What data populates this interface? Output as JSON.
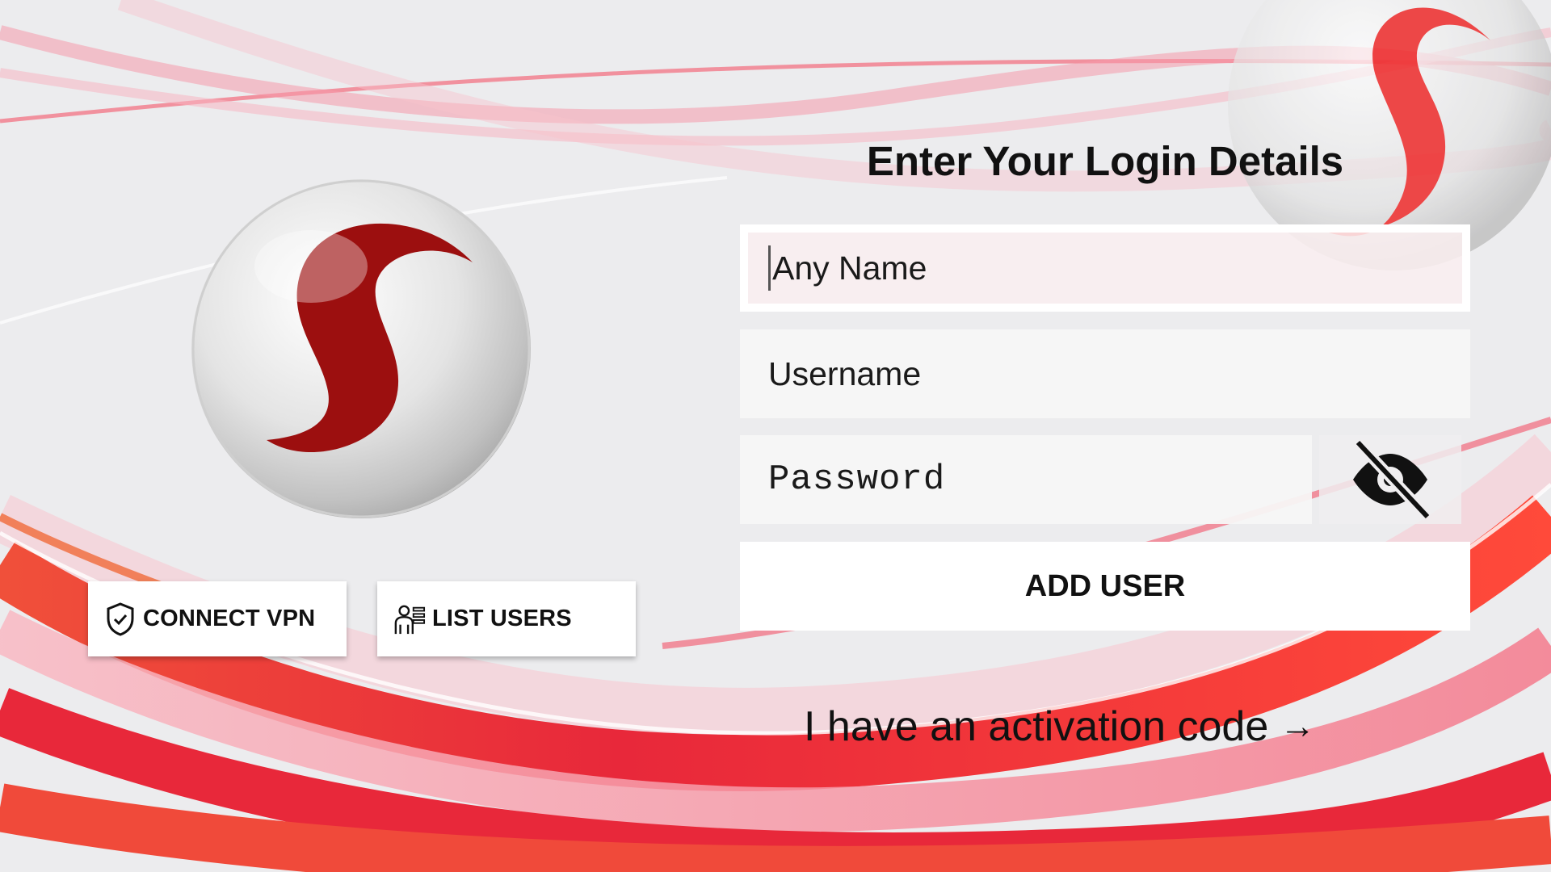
{
  "login": {
    "title": "Enter Your Login Details",
    "fields": {
      "any_name_placeholder": "Any Name",
      "username_placeholder": "Username",
      "password_placeholder": "Password"
    },
    "add_user_label": "ADD USER",
    "activation_link_label": "I have an activation code",
    "activation_arrow": "→"
  },
  "side_buttons": {
    "connect_vpn_label": "CONNECT VPN",
    "list_users_label": "LIST USERS"
  },
  "icons": {
    "vpn": "shield-check-icon",
    "users": "user-list-icon",
    "password_toggle": "eye-off-icon",
    "logo": "s-sphere-logo"
  },
  "colors": {
    "background": "#ececee",
    "brand_red": "#9c0f0f",
    "accent_red": "#e8283a",
    "ribbon_pink": "#f7a6b4",
    "button_bg": "#ffffff",
    "text": "#111111"
  }
}
